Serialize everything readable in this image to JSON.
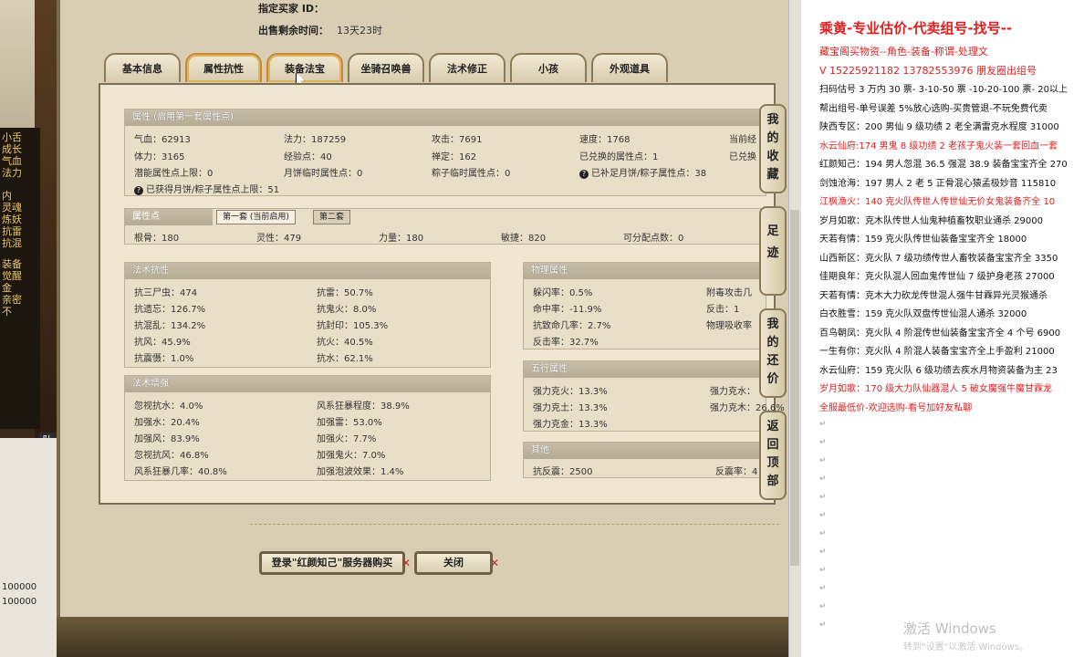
{
  "left": {
    "panel_lines": [
      "小舌",
      "成长",
      "气血",
      "法力",
      "内",
      "灵魂",
      "炼妖",
      "抗雷",
      "抗混",
      "装备",
      "觉醒",
      "金",
      "亲密",
      "不"
    ],
    "numbers": [
      "100000",
      "100000"
    ],
    "queue_label": "队"
  },
  "header": {
    "buyer_label": "指定买家 ID：",
    "time_label": "出售剩余时间：",
    "time_value": "13天23时"
  },
  "tabs": [
    {
      "label": "基本信息"
    },
    {
      "label": "属性抗性"
    },
    {
      "label": "装备法宝"
    },
    {
      "label": "坐骑召唤兽"
    },
    {
      "label": "法术修正"
    },
    {
      "label": "小孩"
    },
    {
      "label": "外观道具"
    }
  ],
  "attr": {
    "title": "属性 (启用第一套属性点)",
    "r1": [
      "气血：62913",
      "法力：187259",
      "攻击：7691",
      "速度：1768",
      "当前经"
    ],
    "r2": [
      "体力：3165",
      "经验点：40",
      "禅定：162",
      "已兑换的属性点：1",
      "已兑换"
    ],
    "r3": [
      "潜能属性点上限：0",
      "月饼临时属性点：0",
      "粽子临时属性点：0",
      "已补足月饼/粽子属性点：38"
    ],
    "r4": "已获得月饼/粽子属性点上限：51"
  },
  "points": {
    "title": "属性点",
    "tab1": "第一套 (当前启用)",
    "tab2": "第二套",
    "row": [
      "根骨：180",
      "灵性：479",
      "力量：180",
      "敏捷：820",
      "可分配点数：0"
    ]
  },
  "resist": {
    "title": "法术抗性",
    "left": [
      "抗三尸虫：474",
      "抗遗忘：126.7%",
      "抗混乱：134.2%",
      "抗风：45.9%",
      "抗震慑：1.0%"
    ],
    "right": [
      "抗雷：50.7%",
      "抗鬼火：8.0%",
      "抗封印：105.3%",
      "抗火：40.5%",
      "抗水：62.1%"
    ]
  },
  "physical": {
    "title": "物理属性",
    "left": [
      "躲闪率：0.5%",
      "命中率：-11.9%",
      "抗致命几率：2.7%",
      "反击率：32.7%"
    ],
    "right": [
      "附毒攻击几",
      "反击：1",
      "物理吸收率"
    ]
  },
  "enhance": {
    "title": "法术增强",
    "left": [
      "忽视抗水：4.0%",
      "加强水：20.4%",
      "加强风：83.9%",
      "忽视抗风：46.8%",
      "风系狂暴几率：40.8%"
    ],
    "right": [
      "风系狂暴程度：38.9%",
      "加强雷：53.0%",
      "加强火：7.7%",
      "加强鬼火：7.0%",
      "加强泡波效果：1.4%"
    ]
  },
  "five": {
    "title": "五行属性",
    "left": [
      "强力克火：13.3%",
      "强力克土：13.3%",
      "强力克金：13.3%"
    ],
    "right": [
      "强力克水：",
      "强力克木：26.6%"
    ]
  },
  "other": {
    "title": "其他",
    "left": "抗反震：2500",
    "right": "反震率：4"
  },
  "side_buttons": [
    {
      "label": "我的收藏"
    },
    {
      "label": "足迹"
    },
    {
      "label": "我的还价"
    },
    {
      "label": "返回顶部"
    }
  ],
  "buttons": {
    "login": "登录\"红颜知己\"服务器购买",
    "close": "关闭",
    "x": "✕"
  },
  "doc": {
    "title": "乘黄-专业估价-代卖组号-找号--",
    "lines": [
      {
        "t": "藏宝阁买物资--角色-装备-称谓-处理文",
        "red": true
      },
      {
        "t": "V 15225921182    13782553976 朋友圈出组号",
        "red": true
      },
      {
        "t": "扫码估号 3 万内 30 票- 3-10-50 票  -10-20-100 票- 20以上",
        "red": false
      },
      {
        "t": "帮出组号-单号误差 5%放心选购-买贵管退-不玩免费代卖",
        "red": false
      },
      {
        "t": "陕西专区：200 男仙 9 级功绩 2 老全满雷克水程度 31000",
        "red": false
      },
      {
        "t": "水云仙府:174 男鬼 8 级功绩 2 老孩子鬼火装一套回血一套",
        "red": true
      },
      {
        "t": "红颜知己：194 男人忽混 36.5 强混 38.9 装备宝宝齐全 270",
        "red": false
      },
      {
        "t": "剑蚀沧海：197 男人 2 老 5 正骨混心猿孟极妙音 115810",
        "red": false
      },
      {
        "t": "江枫渔火：140 克火队传世人传世仙无价女鬼装备齐全 10",
        "red": true
      },
      {
        "t": "岁月如歌：克木队传世人仙鬼种植畜牧职业通杀 29000",
        "red": false
      },
      {
        "t": "天若有情：159 克火队传世仙装备宝宝齐全 18000",
        "red": false
      },
      {
        "t": "山西新区：克火队 7 级功绩传世人畜牧装备宝宝齐全 3350",
        "red": false
      },
      {
        "t": "佳期良年：克火队混人回血鬼传世仙 7 级护身老孩 27000",
        "red": false
      },
      {
        "t": "天若有情：克木大力砍龙传世混人强牛甘霖异光灵猴通杀",
        "red": false
      },
      {
        "t": "白衣胜雪：159 克火队双盘传世仙混人通杀 32000",
        "red": false
      },
      {
        "t": "百鸟朝凤：克火队 4 阶混传世仙装备宝宝齐全 4 个号 6900",
        "red": false
      },
      {
        "t": "一生有你：克火队 4 阶混人装备宝宝齐全上手盈利 21000",
        "red": false
      },
      {
        "t": "水云仙府：159 克火队 6 级功绩去疾水月物资装备为主 23",
        "red": false
      },
      {
        "t": "岁月如歌：170 级大力队仙器混人 5 破女魔强牛魔甘霖龙",
        "red": true
      },
      {
        "t": "全服最低价-欢迎选购-看号加好友私聊",
        "red": true
      }
    ],
    "para_mark": "↵",
    "watermark": "激活 Windows",
    "watermark_sub": "转到\"设置\"以激活 Windows。"
  },
  "colors": {
    "red": "#e02020",
    "frame": "#7a6d52",
    "panel": "#e8dfc8"
  }
}
